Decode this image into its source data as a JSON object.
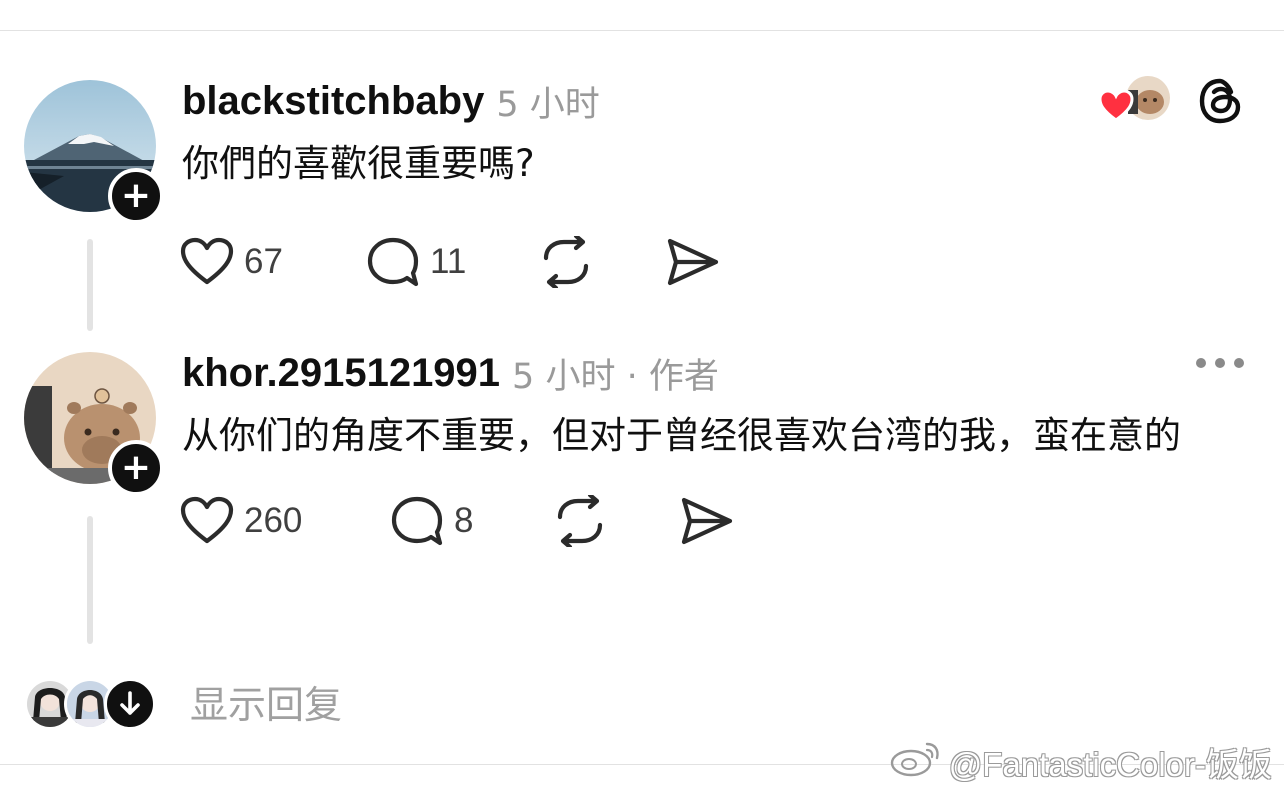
{
  "posts": [
    {
      "username": "blackstitchbaby",
      "time": "5 小时",
      "content": "你們的喜歡很重要嗎?",
      "likes": "67",
      "comments": "11"
    },
    {
      "username": "khor.2915121991",
      "time": "5 小时 · 作者",
      "content": "从你们的角度不重要，但对于曾经很喜欢台湾的我，蛮在意的",
      "likes": "260",
      "comments": "8"
    }
  ],
  "replies": {
    "label": "显示回复"
  },
  "watermark": {
    "text": "@FantasticColor-饭饭"
  },
  "icons": {
    "like": "heart-outline-icon",
    "comment": "comment-bubble-icon",
    "repost": "repost-icon",
    "share": "send-icon",
    "threads": "threads-logo-icon",
    "follow": "plus-icon",
    "more": "more-dots-icon",
    "expand": "arrow-down-icon"
  },
  "colors": {
    "text": "#101010",
    "muted": "#9a9a9a",
    "liked_heart": "#ff3040"
  }
}
